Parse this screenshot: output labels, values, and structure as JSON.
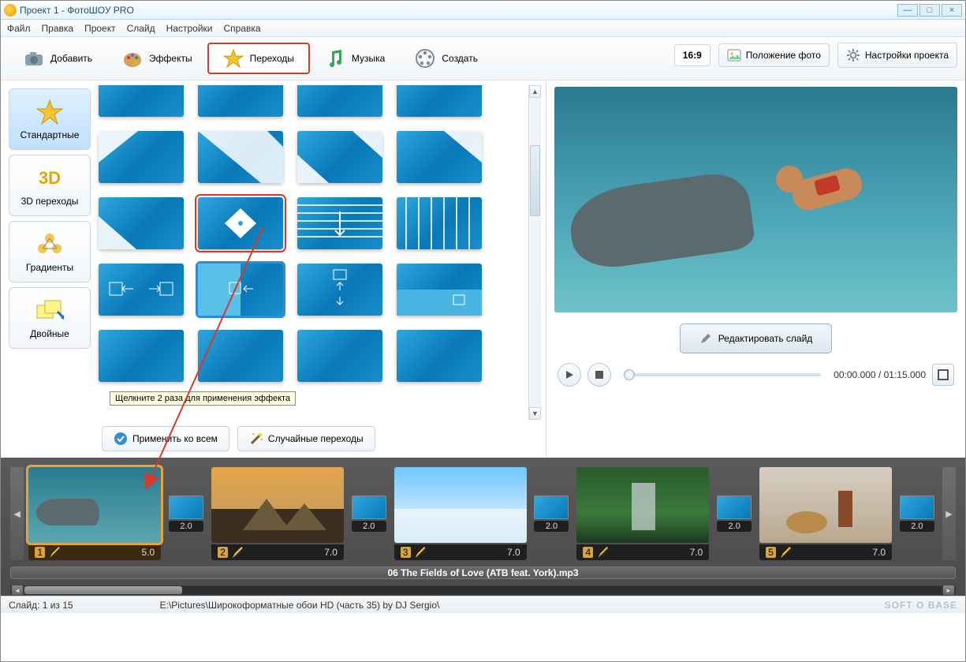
{
  "window": {
    "title": "Проект 1 - ФотоШОУ PRO"
  },
  "menu": {
    "file": "Файл",
    "edit": "Правка",
    "project": "Проект",
    "slide": "Слайд",
    "settings": "Настройки",
    "help": "Справка"
  },
  "toolbar": {
    "add": "Добавить",
    "effects": "Эффекты",
    "transitions": "Переходы",
    "music": "Музыка",
    "create": "Создать",
    "aspect": "16:9",
    "photo_pos": "Положение фото",
    "proj_settings": "Настройки проекта"
  },
  "categories": {
    "standard": "Стандартные",
    "threeD": "3D переходы",
    "gradients": "Градиенты",
    "double": "Двойные"
  },
  "tooltip": "Щелкните 2 раза для применения эффекта",
  "actions": {
    "apply_all": "Применить ко всем",
    "random": "Случайные переходы"
  },
  "preview": {
    "edit_slide": "Редактировать слайд",
    "time_cur": "00:00.000",
    "time_total": "01:15.000"
  },
  "timeline": {
    "slides": [
      {
        "n": "1",
        "dur": "5.0"
      },
      {
        "n": "2",
        "dur": "7.0"
      },
      {
        "n": "3",
        "dur": "7.0"
      },
      {
        "n": "4",
        "dur": "7.0"
      },
      {
        "n": "5",
        "dur": "7.0"
      }
    ],
    "trans_dur": "2.0",
    "audio": "06 The Fields of Love (ATB feat. York).mp3"
  },
  "status": {
    "slide": "Слайд: 1 из 15",
    "path": "E:\\Pictures\\Широкоформатные обои HD (часть 35) by DJ Sergio\\",
    "logo": "SOFT O BASE"
  }
}
